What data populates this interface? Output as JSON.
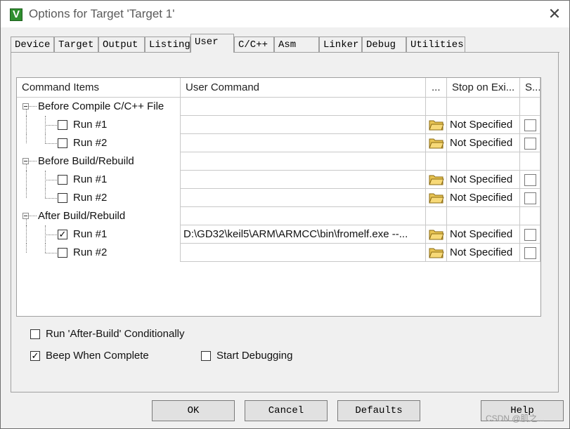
{
  "window": {
    "title": "Options for Target 'Target 1'",
    "close_icon": "close-icon",
    "app_icon": "keil-uvision-icon",
    "app_icon_glyph": "V"
  },
  "tabs": [
    {
      "label": "Device",
      "active": false
    },
    {
      "label": "Target",
      "active": false
    },
    {
      "label": "Output",
      "active": false
    },
    {
      "label": "Listing",
      "active": false
    },
    {
      "label": "User",
      "active": true
    },
    {
      "label": "C/C++",
      "active": false
    },
    {
      "label": "Asm",
      "active": false
    },
    {
      "label": "Linker",
      "active": false
    },
    {
      "label": "Debug",
      "active": false
    },
    {
      "label": "Utilities",
      "active": false
    }
  ],
  "grid": {
    "headers": [
      "Command Items",
      "User Command",
      "...",
      "Stop on Exi...",
      "S..."
    ],
    "groups": [
      {
        "label": "Before Compile C/C++ File",
        "runs": [
          {
            "label": "Run #1",
            "checked": false,
            "command": "",
            "stop": "Not Specified",
            "s_checked": false
          },
          {
            "label": "Run #2",
            "checked": false,
            "command": "",
            "stop": "Not Specified",
            "s_checked": false
          }
        ]
      },
      {
        "label": "Before Build/Rebuild",
        "runs": [
          {
            "label": "Run #1",
            "checked": false,
            "command": "",
            "stop": "Not Specified",
            "s_checked": false
          },
          {
            "label": "Run #2",
            "checked": false,
            "command": "",
            "stop": "Not Specified",
            "s_checked": false
          }
        ]
      },
      {
        "label": "After Build/Rebuild",
        "runs": [
          {
            "label": "Run #1",
            "checked": true,
            "command": "D:\\GD32\\keil5\\ARM\\ARMCC\\bin\\fromelf.exe --...",
            "stop": "Not Specified",
            "s_checked": false
          },
          {
            "label": "Run #2",
            "checked": false,
            "command": "",
            "stop": "Not Specified",
            "s_checked": false
          }
        ]
      }
    ],
    "browse_icon": "folder-open-icon"
  },
  "options": {
    "run_after_build_conditionally": {
      "label": "Run 'After-Build' Conditionally",
      "checked": false
    },
    "beep_when_complete": {
      "label": "Beep When Complete",
      "checked": true
    },
    "start_debugging": {
      "label": "Start Debugging",
      "checked": false
    }
  },
  "buttons": {
    "ok": "OK",
    "cancel": "Cancel",
    "defaults": "Defaults",
    "help": "Help"
  },
  "watermark": "CSDN @肌之..."
}
